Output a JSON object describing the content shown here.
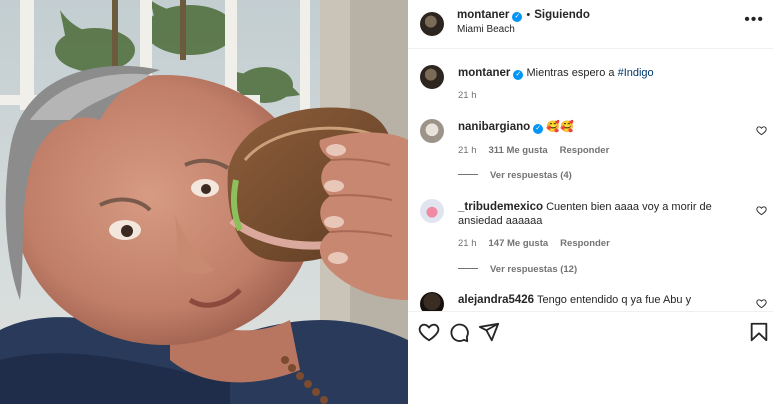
{
  "post": {
    "author": "montaner",
    "follow_label": "Siguiendo",
    "location": "Miami Beach",
    "more_icon": "more-options-icon",
    "caption": {
      "username": "montaner",
      "text": "Mientras espero a ",
      "hashtag": "#Indigo",
      "time": "21 h"
    }
  },
  "comments": [
    {
      "username": "nanibargiano",
      "verified": true,
      "text": "🥰🥰",
      "time": "21 h",
      "likes": "311 Me gusta",
      "reply_label": "Responder",
      "view_replies": "Ver respuestas (4)"
    },
    {
      "username": "_tribudemexico",
      "verified": false,
      "text": "Cuenten bien aaaa voy a morir de ansiedad aaaaaa",
      "time": "21 h",
      "likes": "147 Me gusta",
      "reply_label": "Responder",
      "view_replies": "Ver respuestas (12)"
    },
    {
      "username": "alejandra5426",
      "verified": false,
      "text": "Tengo entendido q ya fue Abu y"
    }
  ],
  "actions": [
    "like-icon",
    "comment-icon",
    "share-icon",
    "save-icon"
  ],
  "colors": {
    "verified": "#0095f6",
    "hashtag": "#00376b",
    "muted": "#737373",
    "text": "#262626"
  }
}
